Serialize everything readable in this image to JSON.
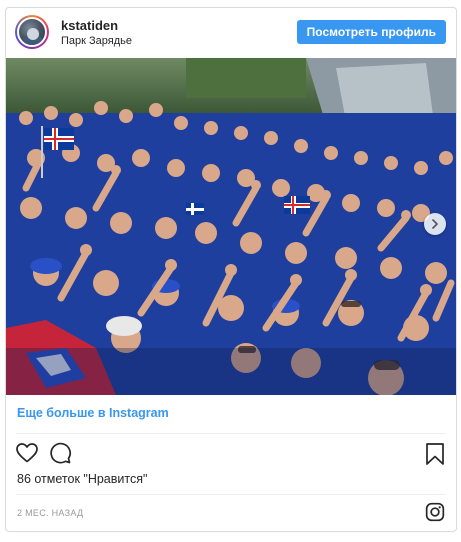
{
  "post": {
    "username": "kstatiden",
    "location": "Парк Зарядье",
    "view_profile_label": "Посмотреть профиль",
    "more_link_label": "Еще больше в Instagram",
    "likes_label": "86 отметок \"Нравится\"",
    "timestamp": "2 МЕС. НАЗАД"
  },
  "icons": {
    "like": "heart-icon",
    "comment": "comment-icon",
    "save": "bookmark-icon",
    "logo": "instagram-icon",
    "carousel": "chevron-right-icon"
  },
  "colors": {
    "accent": "#3897f0",
    "text": "#262626",
    "muted": "#999999",
    "border": "#dbdbdb"
  }
}
